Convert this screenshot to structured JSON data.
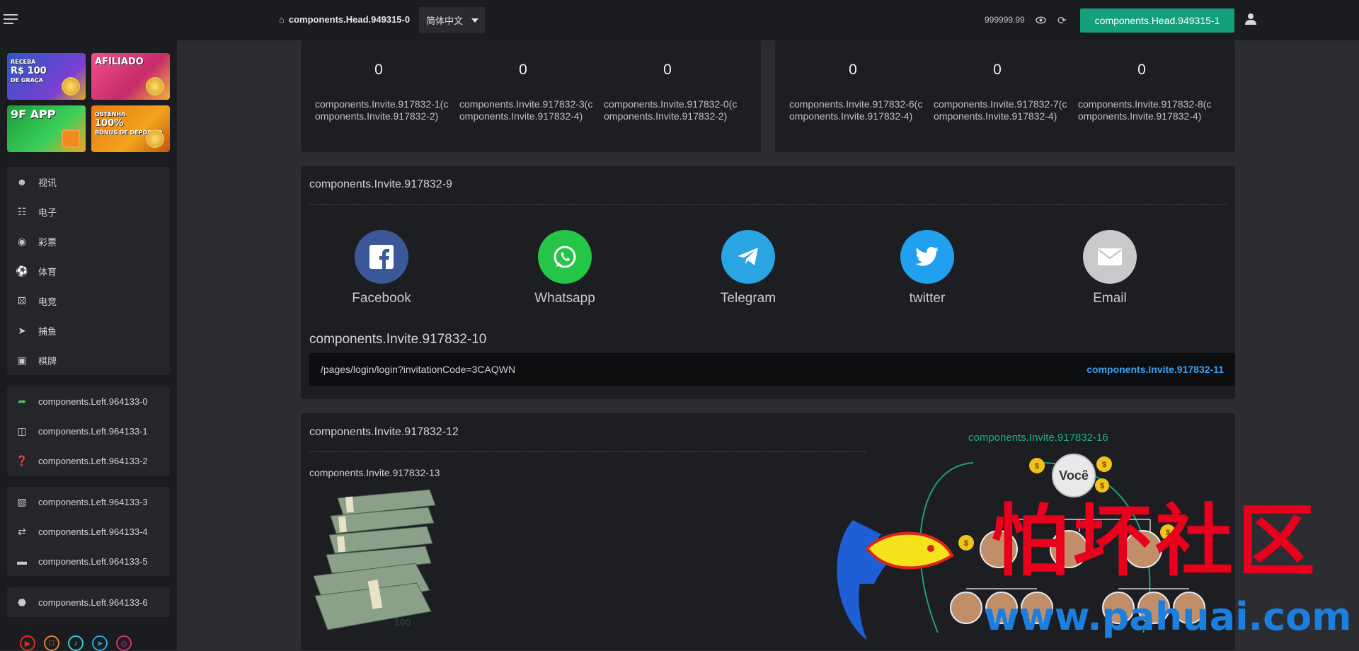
{
  "sidebar": {
    "promos": [
      {
        "top": "RECEBA",
        "main": "R$ 100",
        "sub": "DE GRAÇA"
      },
      {
        "top": "",
        "main": "AFILIADO",
        "sub": ""
      },
      {
        "top": "",
        "main": "9F APP",
        "sub": ""
      },
      {
        "top": "OBTENHA",
        "main": "100%",
        "sub": "BÔNUS DE DEPÓSITO"
      }
    ],
    "games": [
      {
        "label": "视讯",
        "icon": "casino-dealer-icon"
      },
      {
        "label": "电子",
        "icon": "slot-icon"
      },
      {
        "label": "彩票",
        "icon": "lottery-ball-icon"
      },
      {
        "label": "体育",
        "icon": "basketball-icon"
      },
      {
        "label": "电竞",
        "icon": "gamepad-icon"
      },
      {
        "label": "捕鱼",
        "icon": "rocket-icon"
      },
      {
        "label": "棋牌",
        "icon": "cards-icon"
      }
    ],
    "links": [
      {
        "label": "components.Left.964133-0",
        "icon": "share-arrow-icon"
      },
      {
        "label": "components.Left.964133-1",
        "icon": "gift-icon"
      },
      {
        "label": "components.Left.964133-2",
        "icon": "help-icon"
      }
    ],
    "wallet": [
      {
        "label": "components.Left.964133-3",
        "icon": "wallet-icon"
      },
      {
        "label": "components.Left.964133-4",
        "icon": "exchange-icon"
      },
      {
        "label": "components.Left.964133-5",
        "icon": "card-icon"
      }
    ],
    "extra": [
      {
        "label": "components.Left.964133-6",
        "icon": "cube-icon"
      }
    ]
  },
  "header": {
    "breadcrumb": "components.Head.949315-0",
    "language": "简体中文",
    "balance": "999999.99",
    "action_button": "components.Head.949315-1"
  },
  "stats_left": [
    {
      "value": "0",
      "label": "components.Invite.917832-1(components.Invite.917832-2)"
    },
    {
      "value": "0",
      "label": "components.Invite.917832-3(components.Invite.917832-4)"
    },
    {
      "value": "0",
      "label": "components.Invite.917832-0(components.Invite.917832-2)"
    }
  ],
  "stats_right": [
    {
      "value": "0",
      "label": "components.Invite.917832-6(components.Invite.917832-4)"
    },
    {
      "value": "0",
      "label": "components.Invite.917832-7(components.Invite.917832-4)"
    },
    {
      "value": "0",
      "label": "components.Invite.917832-8(components.Invite.917832-4)"
    }
  ],
  "share": {
    "title": "components.Invite.917832-9",
    "targets": [
      {
        "name": "Facebook",
        "color": "#3b5998"
      },
      {
        "name": "Whatsapp",
        "color": "#25c548"
      },
      {
        "name": "Telegram",
        "color": "#2aa5e3"
      },
      {
        "name": "twitter",
        "color": "#21a0ef"
      },
      {
        "name": "Email",
        "color": "#c9c9cc"
      }
    ],
    "link_title": "components.Invite.917832-10",
    "link_url": "/pages/login/login?invitationCode=3CAQWN",
    "copy_label": "components.Invite.917832-11"
  },
  "rewards": {
    "title": "components.Invite.917832-12",
    "subtitle": "components.Invite.917832-13",
    "graph_title": "components.Invite.917832-16",
    "graph_center": "Você"
  },
  "watermark": {
    "text": "怕坏社区",
    "url": "www.pahuai.com"
  },
  "colors": {
    "accent": "#15a07d",
    "link": "#3aa0f0"
  }
}
